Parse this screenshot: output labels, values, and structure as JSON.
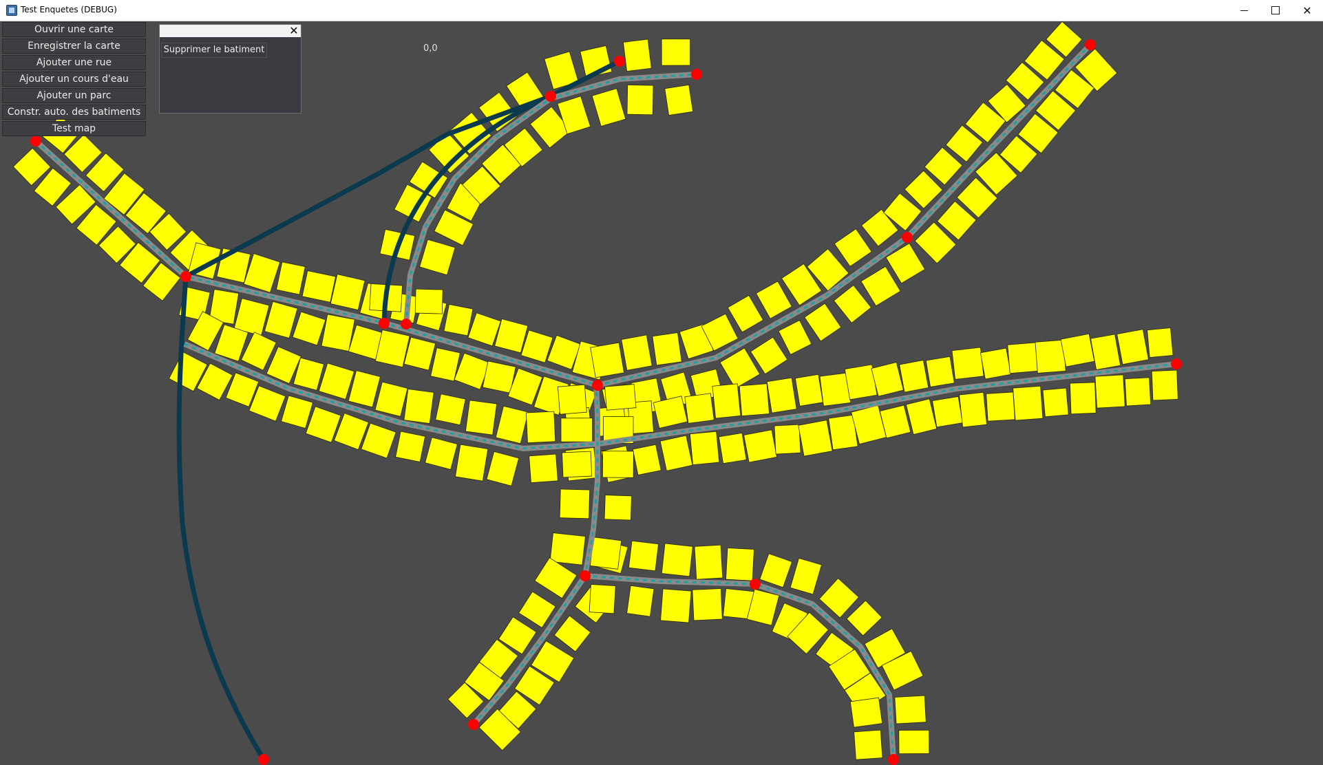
{
  "window": {
    "title": "Test Enquetes (DEBUG)",
    "minimize_icon": "minimize-icon",
    "maximize_icon": "maximize-icon",
    "close_icon": "close-icon",
    "close_glyph": "✕"
  },
  "menu": {
    "items": [
      {
        "label": "Ouvrir une carte"
      },
      {
        "label": "Enregistrer la carte"
      },
      {
        "label": "Ajouter une rue"
      },
      {
        "label": "Ajouter un cours d'eau"
      },
      {
        "label": "Ajouter un parc"
      },
      {
        "label": "Constr. auto. des batiments"
      },
      {
        "label": "Test map"
      }
    ]
  },
  "popup": {
    "close_glyph": "✕",
    "delete_label": "Supprimer le batiment"
  },
  "coords": "0,0",
  "colors": {
    "background": "#4b4b4b",
    "building": "#ffff00",
    "road": "#8a8a8a",
    "road_center": "#1fa0a0",
    "river": "#0b3a4f",
    "node": "#ff0000"
  }
}
